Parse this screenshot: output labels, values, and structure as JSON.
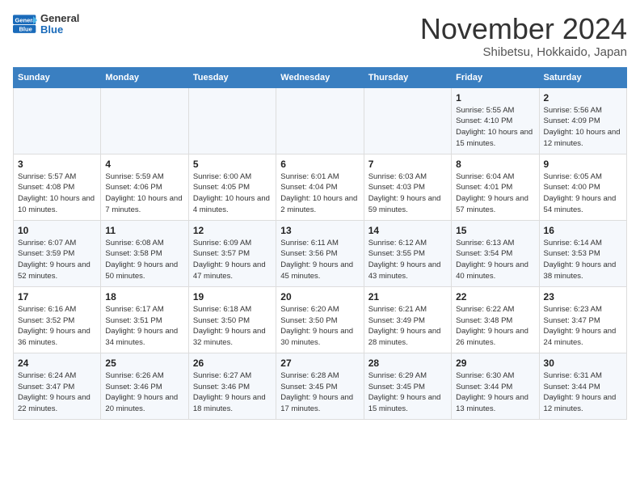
{
  "header": {
    "logo": {
      "text_general": "General",
      "text_blue": "Blue"
    },
    "title": "November 2024",
    "subtitle": "Shibetsu, Hokkaido, Japan"
  },
  "weekdays": [
    "Sunday",
    "Monday",
    "Tuesday",
    "Wednesday",
    "Thursday",
    "Friday",
    "Saturday"
  ],
  "weeks": [
    {
      "days": [
        {
          "number": "",
          "info": ""
        },
        {
          "number": "",
          "info": ""
        },
        {
          "number": "",
          "info": ""
        },
        {
          "number": "",
          "info": ""
        },
        {
          "number": "",
          "info": ""
        },
        {
          "number": "1",
          "info": "Sunrise: 5:55 AM\nSunset: 4:10 PM\nDaylight: 10 hours and 15 minutes."
        },
        {
          "number": "2",
          "info": "Sunrise: 5:56 AM\nSunset: 4:09 PM\nDaylight: 10 hours and 12 minutes."
        }
      ]
    },
    {
      "days": [
        {
          "number": "3",
          "info": "Sunrise: 5:57 AM\nSunset: 4:08 PM\nDaylight: 10 hours and 10 minutes."
        },
        {
          "number": "4",
          "info": "Sunrise: 5:59 AM\nSunset: 4:06 PM\nDaylight: 10 hours and 7 minutes."
        },
        {
          "number": "5",
          "info": "Sunrise: 6:00 AM\nSunset: 4:05 PM\nDaylight: 10 hours and 4 minutes."
        },
        {
          "number": "6",
          "info": "Sunrise: 6:01 AM\nSunset: 4:04 PM\nDaylight: 10 hours and 2 minutes."
        },
        {
          "number": "7",
          "info": "Sunrise: 6:03 AM\nSunset: 4:03 PM\nDaylight: 9 hours and 59 minutes."
        },
        {
          "number": "8",
          "info": "Sunrise: 6:04 AM\nSunset: 4:01 PM\nDaylight: 9 hours and 57 minutes."
        },
        {
          "number": "9",
          "info": "Sunrise: 6:05 AM\nSunset: 4:00 PM\nDaylight: 9 hours and 54 minutes."
        }
      ]
    },
    {
      "days": [
        {
          "number": "10",
          "info": "Sunrise: 6:07 AM\nSunset: 3:59 PM\nDaylight: 9 hours and 52 minutes."
        },
        {
          "number": "11",
          "info": "Sunrise: 6:08 AM\nSunset: 3:58 PM\nDaylight: 9 hours and 50 minutes."
        },
        {
          "number": "12",
          "info": "Sunrise: 6:09 AM\nSunset: 3:57 PM\nDaylight: 9 hours and 47 minutes."
        },
        {
          "number": "13",
          "info": "Sunrise: 6:11 AM\nSunset: 3:56 PM\nDaylight: 9 hours and 45 minutes."
        },
        {
          "number": "14",
          "info": "Sunrise: 6:12 AM\nSunset: 3:55 PM\nDaylight: 9 hours and 43 minutes."
        },
        {
          "number": "15",
          "info": "Sunrise: 6:13 AM\nSunset: 3:54 PM\nDaylight: 9 hours and 40 minutes."
        },
        {
          "number": "16",
          "info": "Sunrise: 6:14 AM\nSunset: 3:53 PM\nDaylight: 9 hours and 38 minutes."
        }
      ]
    },
    {
      "days": [
        {
          "number": "17",
          "info": "Sunrise: 6:16 AM\nSunset: 3:52 PM\nDaylight: 9 hours and 36 minutes."
        },
        {
          "number": "18",
          "info": "Sunrise: 6:17 AM\nSunset: 3:51 PM\nDaylight: 9 hours and 34 minutes."
        },
        {
          "number": "19",
          "info": "Sunrise: 6:18 AM\nSunset: 3:50 PM\nDaylight: 9 hours and 32 minutes."
        },
        {
          "number": "20",
          "info": "Sunrise: 6:20 AM\nSunset: 3:50 PM\nDaylight: 9 hours and 30 minutes."
        },
        {
          "number": "21",
          "info": "Sunrise: 6:21 AM\nSunset: 3:49 PM\nDaylight: 9 hours and 28 minutes."
        },
        {
          "number": "22",
          "info": "Sunrise: 6:22 AM\nSunset: 3:48 PM\nDaylight: 9 hours and 26 minutes."
        },
        {
          "number": "23",
          "info": "Sunrise: 6:23 AM\nSunset: 3:47 PM\nDaylight: 9 hours and 24 minutes."
        }
      ]
    },
    {
      "days": [
        {
          "number": "24",
          "info": "Sunrise: 6:24 AM\nSunset: 3:47 PM\nDaylight: 9 hours and 22 minutes."
        },
        {
          "number": "25",
          "info": "Sunrise: 6:26 AM\nSunset: 3:46 PM\nDaylight: 9 hours and 20 minutes."
        },
        {
          "number": "26",
          "info": "Sunrise: 6:27 AM\nSunset: 3:46 PM\nDaylight: 9 hours and 18 minutes."
        },
        {
          "number": "27",
          "info": "Sunrise: 6:28 AM\nSunset: 3:45 PM\nDaylight: 9 hours and 17 minutes."
        },
        {
          "number": "28",
          "info": "Sunrise: 6:29 AM\nSunset: 3:45 PM\nDaylight: 9 hours and 15 minutes."
        },
        {
          "number": "29",
          "info": "Sunrise: 6:30 AM\nSunset: 3:44 PM\nDaylight: 9 hours and 13 minutes."
        },
        {
          "number": "30",
          "info": "Sunrise: 6:31 AM\nSunset: 3:44 PM\nDaylight: 9 hours and 12 minutes."
        }
      ]
    }
  ]
}
